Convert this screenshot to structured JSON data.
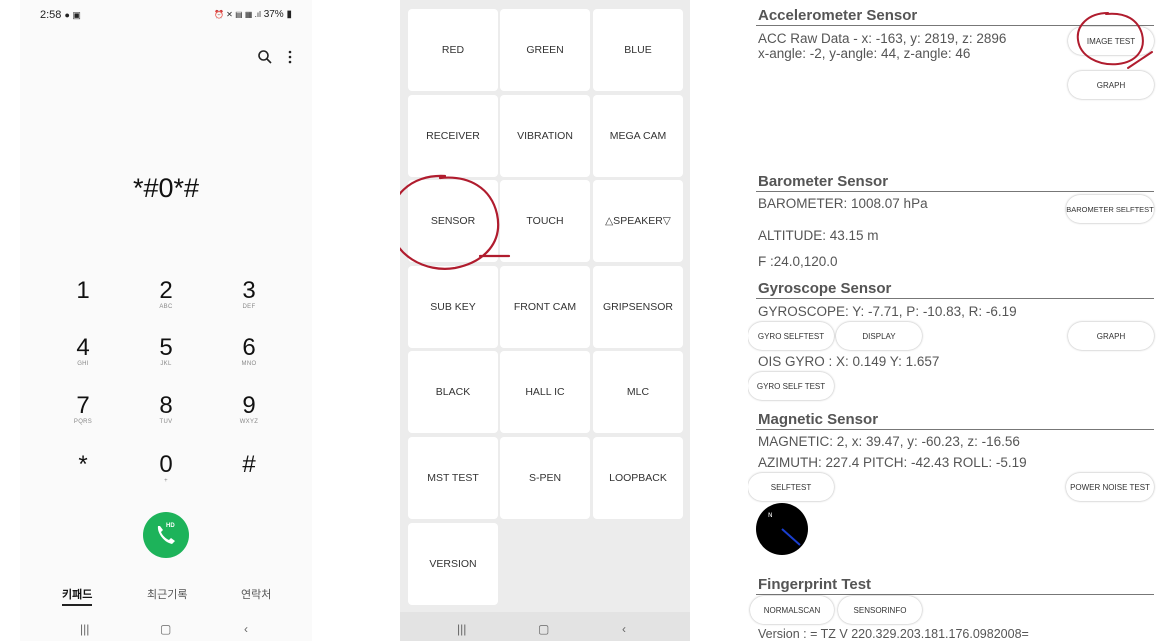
{
  "dialer": {
    "status_time": "2:58",
    "status_right": "37%",
    "dialed_number": "*#0*#",
    "keys": [
      {
        "digit": "1",
        "letters": ""
      },
      {
        "digit": "2",
        "letters": "ABC"
      },
      {
        "digit": "3",
        "letters": "DEF"
      },
      {
        "digit": "4",
        "letters": "GHI"
      },
      {
        "digit": "5",
        "letters": "JKL"
      },
      {
        "digit": "6",
        "letters": "MNO"
      },
      {
        "digit": "7",
        "letters": "PQRS"
      },
      {
        "digit": "8",
        "letters": "TUV"
      },
      {
        "digit": "9",
        "letters": "WXYZ"
      },
      {
        "digit": "*",
        "letters": ""
      },
      {
        "digit": "0",
        "letters": "+"
      },
      {
        "digit": "#",
        "letters": ""
      }
    ],
    "call_badge": "HD",
    "tabs": [
      "키패드",
      "최근기록",
      "연락처"
    ],
    "accent": "#1db35a"
  },
  "test_menu": {
    "tiles": [
      "RED",
      "GREEN",
      "BLUE",
      "RECEIVER",
      "VIBRATION",
      "MEGA CAM",
      "SENSOR",
      "TOUCH",
      "△SPEAKER▽",
      "SUB KEY",
      "FRONT CAM",
      "GRIPSENSOR",
      "BLACK",
      "HALL IC",
      "MLC",
      "MST TEST",
      "S-PEN",
      "LOOPBACK",
      "VERSION"
    ]
  },
  "sensor": {
    "accel": {
      "title": "Accelerometer Sensor",
      "raw": "ACC Raw Data - x: -163, y: 2819, z: 2896",
      "angle": "x-angle: -2, y-angle: 44, z-angle: 46",
      "image_test_btn": "IMAGE TEST",
      "graph_btn": "GRAPH"
    },
    "baro": {
      "title": "Barometer Sensor",
      "value": "BAROMETER: 1008.07 hPa",
      "selftest_btn": "BAROMETER SELFTEST",
      "altitude": "ALTITUDE: 43.15 m",
      "f_value": "F :24.0,120.0"
    },
    "gyro": {
      "title": "Gyroscope Sensor",
      "value": "GYROSCOPE: Y: -7.71, P: -10.83, R: -6.19",
      "selftest_btn": "GYRO SELFTEST",
      "display_btn": "DISPLAY",
      "graph_btn": "GRAPH",
      "ois": "OIS GYRO : X: 0.149 Y: 1.657",
      "ois_selftest_btn": "GYRO SELF TEST"
    },
    "mag": {
      "title": "Magnetic Sensor",
      "value": "MAGNETIC: 2, x: 39.47, y: -60.23, z: -16.56",
      "orientation": "AZIMUTH: 227.4   PITCH: -42.43   ROLL: -5.19",
      "selftest_btn": "SELFTEST",
      "power_noise_btn": "POWER NOISE TEST"
    },
    "finger": {
      "title": "Fingerprint Test",
      "normalscan_btn": "NORMALSCAN",
      "sensorinfo_btn": "SENSORINFO",
      "version": "Version : = TZ V 220.329.203.181.176.0982008="
    }
  },
  "annotation_color": "#b01c2e"
}
